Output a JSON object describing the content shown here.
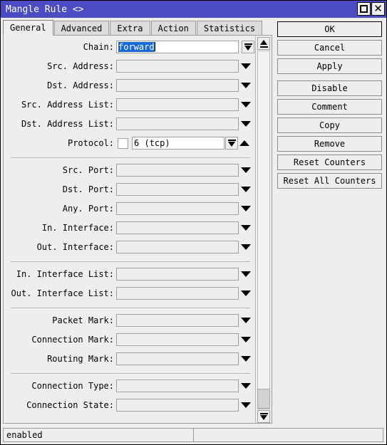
{
  "window": {
    "title": "Mangle Rule <>",
    "controls": [
      {
        "name": "maximize-button",
        "icon": "maximize-icon"
      },
      {
        "name": "close-button",
        "icon": "close-icon",
        "glyph": "✕"
      }
    ]
  },
  "tabs": [
    {
      "label": "General",
      "active": true
    },
    {
      "label": "Advanced",
      "active": false
    },
    {
      "label": "Extra",
      "active": false
    },
    {
      "label": "Action",
      "active": false
    },
    {
      "label": "Statistics",
      "active": false
    }
  ],
  "form": {
    "groups": [
      {
        "fields": [
          {
            "label": "Chain:",
            "value": "forward",
            "selected": true,
            "input_style": "white",
            "control": "boxed-dropdown"
          },
          {
            "label": "Src. Address:",
            "value": "",
            "input_style": "grey",
            "control": "triangle-down"
          },
          {
            "label": "Dst. Address:",
            "value": "",
            "input_style": "grey",
            "control": "triangle-down"
          },
          {
            "label": "Src. Address List:",
            "value": "",
            "input_style": "grey",
            "control": "triangle-down"
          },
          {
            "label": "Dst. Address List:",
            "value": "",
            "input_style": "grey",
            "control": "triangle-down"
          },
          {
            "label": "Protocol:",
            "value": "6 (tcp)",
            "input_style": "white",
            "checkbox": true,
            "checked": false,
            "control": "boxed-dropdown",
            "extra_control": "triangle-up"
          }
        ]
      },
      {
        "fields": [
          {
            "label": "Src. Port:",
            "value": "",
            "input_style": "grey",
            "control": "triangle-down"
          },
          {
            "label": "Dst. Port:",
            "value": "",
            "input_style": "grey",
            "control": "triangle-down"
          },
          {
            "label": "Any. Port:",
            "value": "",
            "input_style": "grey",
            "control": "triangle-down"
          },
          {
            "label": "In. Interface:",
            "value": "",
            "input_style": "grey",
            "control": "triangle-down"
          },
          {
            "label": "Out. Interface:",
            "value": "",
            "input_style": "grey",
            "control": "triangle-down"
          }
        ]
      },
      {
        "fields": [
          {
            "label": "In. Interface List:",
            "value": "",
            "input_style": "grey",
            "control": "triangle-down"
          },
          {
            "label": "Out. Interface List:",
            "value": "",
            "input_style": "grey",
            "control": "triangle-down"
          }
        ]
      },
      {
        "fields": [
          {
            "label": "Packet Mark:",
            "value": "",
            "input_style": "grey",
            "control": "triangle-down"
          },
          {
            "label": "Connection Mark:",
            "value": "",
            "input_style": "grey",
            "control": "triangle-down"
          },
          {
            "label": "Routing Mark:",
            "value": "",
            "input_style": "grey",
            "control": "triangle-down"
          }
        ]
      },
      {
        "fields": [
          {
            "label": "Connection Type:",
            "value": "",
            "input_style": "grey",
            "control": "triangle-down"
          },
          {
            "label": "Connection State:",
            "value": "",
            "input_style": "grey",
            "control": "triangle-down"
          }
        ]
      }
    ]
  },
  "buttons": [
    {
      "label": "OK",
      "default": true,
      "gap": false
    },
    {
      "label": "Cancel",
      "default": false,
      "gap": false
    },
    {
      "label": "Apply",
      "default": false,
      "gap": false
    },
    {
      "label": "Disable",
      "default": false,
      "gap": true
    },
    {
      "label": "Comment",
      "default": false,
      "gap": false
    },
    {
      "label": "Copy",
      "default": false,
      "gap": false
    },
    {
      "label": "Remove",
      "default": false,
      "gap": false
    },
    {
      "label": "Reset Counters",
      "default": false,
      "gap": false
    },
    {
      "label": "Reset All Counters",
      "default": false,
      "gap": false
    }
  ],
  "statusbar": {
    "left": "enabled",
    "right": ""
  },
  "scrollbar": {
    "up_icon": "scroll-up-icon",
    "down_icon": "scroll-down-icon",
    "thumb_position": "bottom"
  },
  "colors": {
    "titlebar": "#4b4bc4",
    "face": "#eeeeee",
    "selection": "#1669d8",
    "border": "#9a9a9a"
  }
}
